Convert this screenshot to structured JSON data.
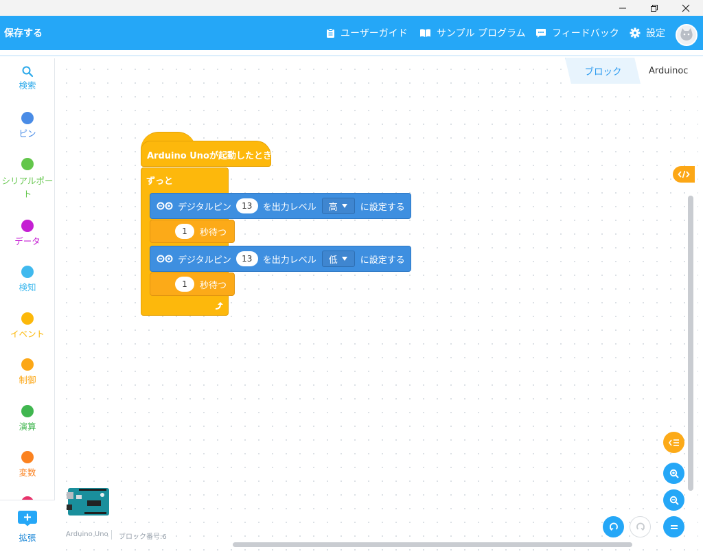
{
  "header": {
    "save_label": "保存する",
    "user_guide": "ユーザーガイド",
    "sample_program": "サンプル プログラム",
    "feedback": "フィードバック",
    "settings": "設定"
  },
  "tabs": {
    "block": "ブロック",
    "code": "Arduinoc"
  },
  "sidebar": {
    "items": [
      {
        "label": "検索",
        "color": "#29a8ea"
      },
      {
        "label": "ピン",
        "color": "#4a8ce6"
      },
      {
        "label": "シリアルポート",
        "color": "#63c64b"
      },
      {
        "label": "データ",
        "color": "#c51fd3"
      },
      {
        "label": "検知",
        "color": "#40b9ee"
      },
      {
        "label": "イベント",
        "color": "#fcb80a"
      },
      {
        "label": "制御",
        "color": "#fca716"
      },
      {
        "label": "演算",
        "color": "#40b64f"
      },
      {
        "label": "変数",
        "color": "#fb8220"
      }
    ],
    "extension_label": "拡張"
  },
  "blocks": {
    "hat": "Arduino Unoが起動したとき",
    "forever": "ずっと",
    "digital1": {
      "prefix": "デジタルピン",
      "pin": "13",
      "mid": "を出力レベル",
      "level": "高",
      "suffix": "に設定する"
    },
    "wait1": {
      "value": "1",
      "label": "秒待つ"
    },
    "digital2": {
      "prefix": "デジタルピン",
      "pin": "13",
      "mid": "を出力レベル",
      "level": "低",
      "suffix": "に設定する"
    },
    "wait2": {
      "value": "1",
      "label": "秒待つ"
    }
  },
  "footer": {
    "board": "Arduino Uno",
    "block_count": "ブロック番号:6"
  },
  "colors": {
    "header": "#25a7f7",
    "event": "#fdb80c",
    "control": "#fcaa18",
    "pin": "#3e8fe0"
  }
}
